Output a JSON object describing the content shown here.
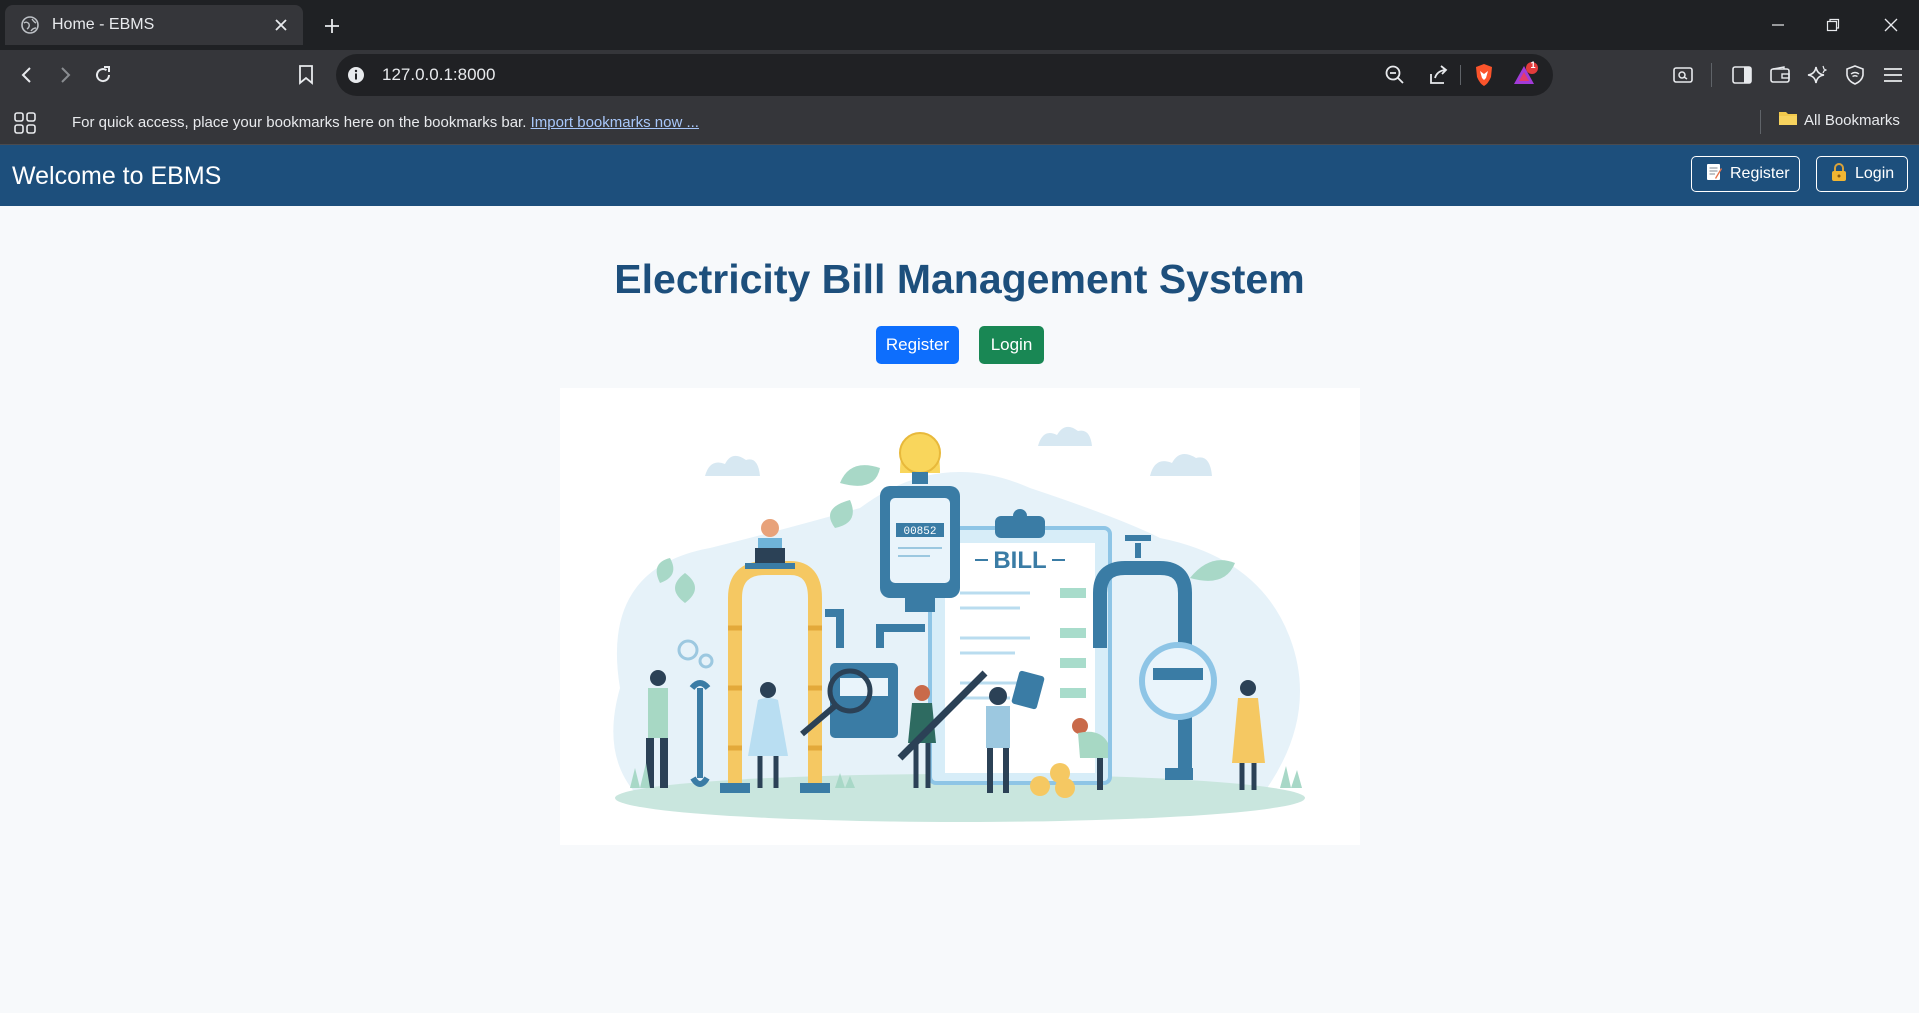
{
  "browser": {
    "tab": {
      "title": "Home - EBMS"
    },
    "address": {
      "url": "127.0.0.1:8000"
    },
    "brave_badge": "1",
    "bookmarks_bar": {
      "message": "For quick access, place your bookmarks here on the bookmarks bar.",
      "import_link": "Import bookmarks now ...",
      "all_bookmarks": "All Bookmarks"
    }
  },
  "app": {
    "brand": "Welcome to EBMS",
    "header": {
      "register_label": "Register",
      "login_label": "Login"
    },
    "main": {
      "title": "Electricity Bill Management System",
      "register_label": "Register",
      "login_label": "Login",
      "illustration": {
        "bill_text": "BILL",
        "meter_reading": "00852"
      }
    }
  },
  "colors": {
    "header_bg": "#1d4f7c",
    "register_btn": "#0d6efd",
    "login_btn": "#198754",
    "title": "#1d4f7c"
  }
}
